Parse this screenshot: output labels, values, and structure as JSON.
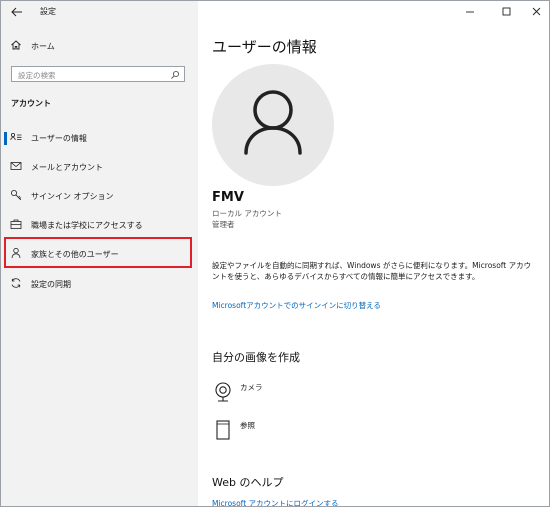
{
  "app": {
    "title": "設定"
  },
  "sidebar": {
    "home_label": "ホーム",
    "search_placeholder": "設定の検索",
    "section_label": "アカウント",
    "items": [
      {
        "label": "ユーザーの情報",
        "icon": "user-info-icon"
      },
      {
        "label": "メールとアカウント",
        "icon": "mail-icon"
      },
      {
        "label": "サインイン オプション",
        "icon": "key-icon"
      },
      {
        "label": "職場または学校にアクセスする",
        "icon": "briefcase-icon"
      },
      {
        "label": "家族とその他のユーザー",
        "icon": "person-icon"
      },
      {
        "label": "設定の同期",
        "icon": "sync-icon"
      }
    ]
  },
  "main": {
    "title": "ユーザーの情報",
    "user_name": "FMV",
    "account_type": "ローカル アカウント",
    "role": "管理者",
    "description": "設定やファイルを自動的に同期すれば、Windows がさらに便利になります。Microsoft アカウントを使うと、あらゆるデバイスからすべての情報に簡単にアクセスできます。",
    "signin_link": "Microsoftアカウントでのサインインに切り替える",
    "create_picture_heading": "自分の画像を作成",
    "camera_label": "カメラ",
    "browse_label": "参照",
    "web_help_heading": "Web のヘルプ",
    "web_help_link": "Microsoft アカウントにログインする"
  },
  "colors": {
    "accent": "#0067c0",
    "highlight": "#e0202a",
    "sidebar_bg": "#f2f2f2"
  }
}
